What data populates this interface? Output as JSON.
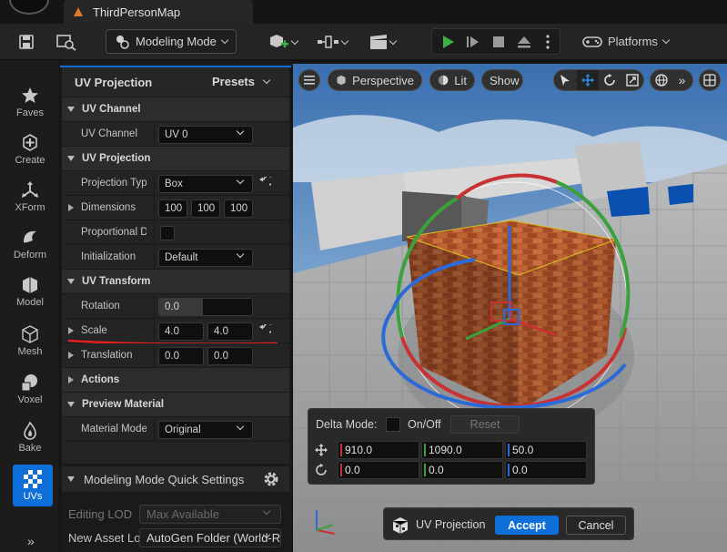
{
  "title_bar": {
    "map_tab_label": "ThirdPersonMap"
  },
  "toolbar": {
    "mode_combo_label": "Modeling Mode",
    "platforms_label": "Platforms"
  },
  "modebar": {
    "items": [
      {
        "label": "Faves",
        "icon": "star-icon"
      },
      {
        "label": "Create",
        "icon": "create-icon"
      },
      {
        "label": "XForm",
        "icon": "xform-icon"
      },
      {
        "label": "Deform",
        "icon": "deform-icon"
      },
      {
        "label": "Model",
        "icon": "model-icon"
      },
      {
        "label": "Mesh",
        "icon": "mesh-icon"
      },
      {
        "label": "Voxel",
        "icon": "voxel-icon"
      },
      {
        "label": "Bake",
        "icon": "bake-icon"
      },
      {
        "label": "UVs",
        "icon": "uvs-icon"
      }
    ],
    "more_label": "»"
  },
  "panel": {
    "title": "UV Projection",
    "presets_label": "Presets",
    "uv_channel": {
      "section": "UV Channel",
      "label": "UV Channel",
      "value": "UV 0"
    },
    "uv_projection": {
      "section": "UV Projection",
      "projection_type_label": "Projection Type",
      "projection_type_value": "Box",
      "dimensions_label": "Dimensions",
      "dimensions": [
        "100",
        "100",
        "100"
      ],
      "proportional_label": "Proportional Dimension",
      "initialization_label": "Initialization",
      "initialization_value": "Default"
    },
    "uv_transform": {
      "section": "UV Transform",
      "rotation_label": "Rotation",
      "rotation_value": "0.0",
      "scale_label": "Scale",
      "scale": [
        "4.0",
        "4.0"
      ],
      "translation_label": "Translation",
      "translation": [
        "0.0",
        "0.0"
      ]
    },
    "actions_section": "Actions",
    "preview_material": {
      "section": "Preview Material",
      "label": "Material Mode",
      "value": "Original"
    },
    "quick_settings": {
      "title": "Modeling Mode Quick Settings",
      "editing_lod_label": "Editing LOD",
      "editing_lod_value": "Max Available",
      "new_asset_label": "New Asset Location",
      "new_asset_value": "AutoGen Folder (World-Relative)"
    }
  },
  "viewport": {
    "perspective_label": "Perspective",
    "lit_label": "Lit",
    "show_label": "Show",
    "delta_mode_label": "Delta Mode:",
    "onoff_label": "On/Off",
    "reset_label": "Reset",
    "location": [
      "910.0",
      "1090.0",
      "50.0"
    ],
    "rotation": [
      "0.0",
      "0.0",
      "0.0"
    ],
    "axis_colors": {
      "x": "#c83232",
      "y": "#3ca03c",
      "z": "#2c6ad8"
    },
    "tool_title": "UV Projection",
    "accept_label": "Accept",
    "cancel_label": "Cancel"
  },
  "accent_color": "#0e6fd8"
}
